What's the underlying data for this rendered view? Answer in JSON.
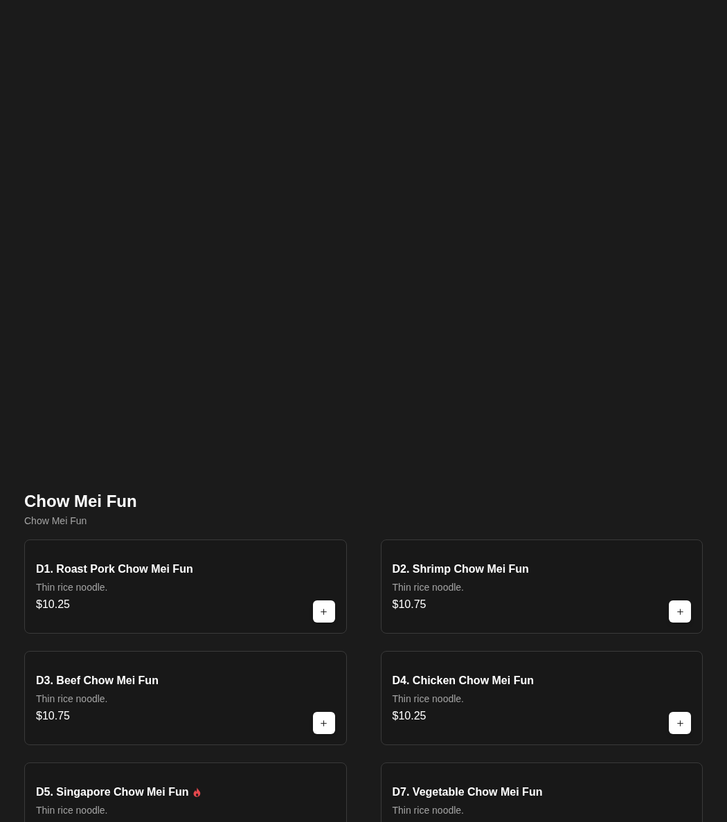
{
  "section": {
    "title": "Chow Mei Fun",
    "subtitle": "Chow Mei Fun"
  },
  "items": [
    {
      "name": "D1. Roast Pork Chow Mei Fun",
      "spicy": false,
      "description": "Thin rice noodle.",
      "price": "$10.25"
    },
    {
      "name": "D2. Shrimp Chow Mei Fun",
      "spicy": false,
      "description": "Thin rice noodle.",
      "price": "$10.75"
    },
    {
      "name": "D3. Beef Chow Mei Fun",
      "spicy": false,
      "description": "Thin rice noodle.",
      "price": "$10.75"
    },
    {
      "name": "D4. Chicken Chow Mei Fun",
      "spicy": false,
      "description": "Thin rice noodle.",
      "price": "$10.25"
    },
    {
      "name": "D5. Singapore Chow Mei Fun",
      "spicy": true,
      "description": "Thin rice noodle."
    },
    {
      "name": "D7. Vegetable Chow Mei Fun",
      "spicy": false,
      "description": "Thin rice noodle."
    }
  ]
}
